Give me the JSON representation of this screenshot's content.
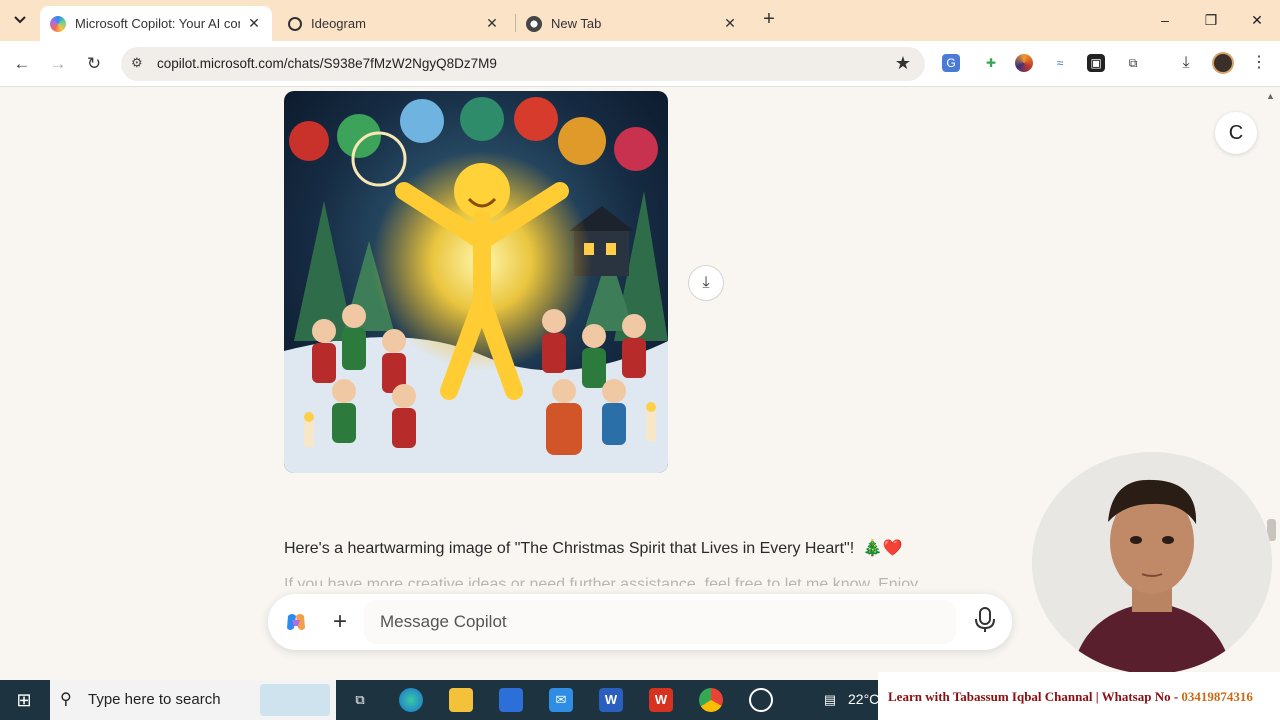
{
  "browser": {
    "tabs": [
      {
        "title": "Microsoft Copilot: Your AI comp",
        "active": true
      },
      {
        "title": "Ideogram",
        "active": false
      },
      {
        "title": "New Tab",
        "active": false
      }
    ],
    "url": "copilot.microsoft.com/chats/S938e7fMzW2NgyQ8Dz7M9",
    "window_controls": {
      "minimize": "–",
      "restore": "❐",
      "close": "✕"
    }
  },
  "chat": {
    "corner_button": "C",
    "reply_text": "Here's a heartwarming image of \"The Christmas Spirit that Lives in Every Heart\"!",
    "reply_emojis": "🎄❤️",
    "faded_text": "If you have more creative ideas or need further assistance, feel free to let me know. Enjoy",
    "composer": {
      "placeholder": "Message Copilot"
    }
  },
  "taskbar": {
    "search_text": "Type here to search",
    "temperature": "22°C"
  },
  "banner": {
    "text": "Learn with Tabassum Iqbal Channal | Whatsap No - ",
    "phone": "03419874316"
  },
  "colors": {
    "tabstrip": "#fbe3c8",
    "taskbar": "#1d3340",
    "page_bg": "#f9f6f2"
  }
}
